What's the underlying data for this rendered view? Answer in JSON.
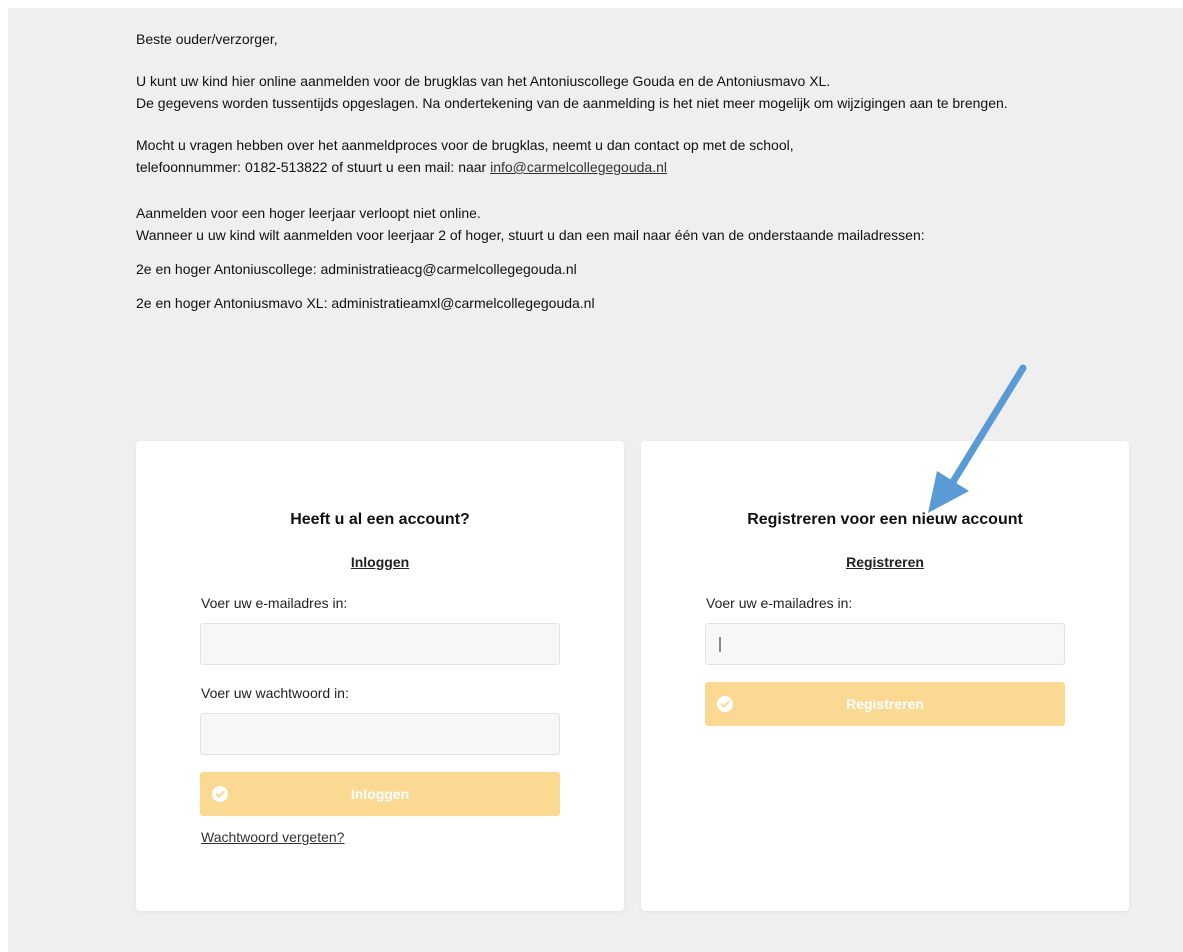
{
  "intro": {
    "greeting": "Beste ouder/verzorger,",
    "line1": "U kunt uw kind hier online aanmelden voor de brugklas van het Antoniuscollege Gouda en de Antoniusmavo XL.",
    "line2": "De gegevens worden tussentijds opgeslagen. Na ondertekening van de aanmelding is het niet meer mogelijk om wijzigingen aan te brengen.",
    "contact_line1": "Mocht u vragen hebben over het aanmeldproces voor de brugklas, neemt u dan contact op met de school,",
    "contact_line2_prefix": "telefoonnummer: 0182-513822 of stuurt u een mail: naar ",
    "contact_email": "info@carmelcollegegouda.nl",
    "higher_line1": "Aanmelden voor een hoger leerjaar verloopt niet online.",
    "higher_line2": "Wanneer u uw kind wilt aanmelden voor leerjaar 2 of hoger, stuurt u dan een mail naar één van de onderstaande mailadressen:",
    "acg_line": "2e en hoger Antoniuscollege: administratieacg@carmelcollegegouda.nl",
    "amxl_line": "2e en hoger Antoniusmavo XL: administratieamxl@carmelcollegegouda.nl"
  },
  "login": {
    "title": "Heeft u al een account?",
    "link": "Inloggen",
    "email_label": "Voer uw e-mailadres in:",
    "email_value": "",
    "password_label": "Voer uw wachtwoord in:",
    "password_value": "",
    "button": "Inloggen",
    "forgot": "Wachtwoord vergeten?"
  },
  "register": {
    "title": "Registreren voor een nieuw account",
    "link": "Registreren",
    "email_label": "Voer uw e-mailadres in:",
    "email_value": "",
    "button": "Registreren"
  },
  "colors": {
    "page_bg": "#efefef",
    "button_bg": "#fbd992",
    "annotation_arrow": "#5b9bd5"
  },
  "icons": {
    "button_icon": "check-circle-icon",
    "annotation": "arrow-annotation"
  }
}
